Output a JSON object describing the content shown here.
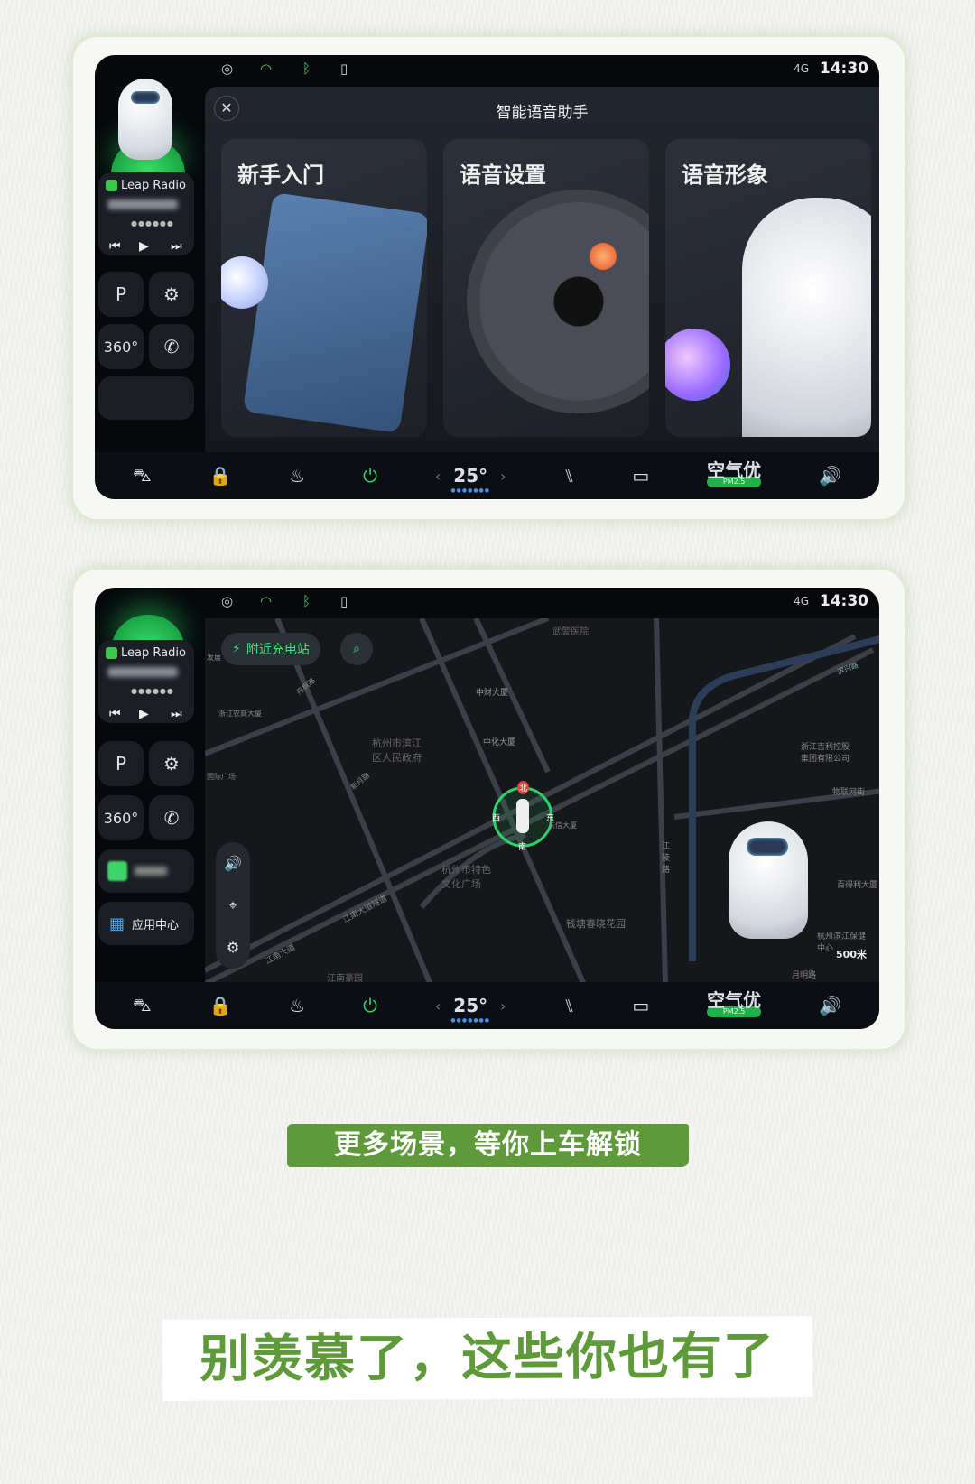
{
  "status": {
    "icons": [
      "user-icon",
      "wifi-icon",
      "bluetooth-icon",
      "phone-projection-icon"
    ],
    "signal": "4G",
    "time": "14:30"
  },
  "sidebar": {
    "radio_title": "Leap Radio",
    "app_center": "应用中心",
    "view_360": "360°"
  },
  "screen1": {
    "panel_title": "智能语音助手",
    "cards": [
      {
        "label": "新手入门"
      },
      {
        "label": "语音设置"
      },
      {
        "label": "语音形象"
      }
    ]
  },
  "screen2": {
    "charging_chip": "附近充电站",
    "scale": "500米",
    "map_labels": [
      "武警医院",
      "中财大厦",
      "中化大厦",
      "杭州市滨江区人民政府",
      "浙江吉利控股集团有限公司",
      "物联网街",
      "江陵路",
      "杭州市特色文化广场",
      "钱塘春晓花园",
      "江南大道隧道",
      "江南大道",
      "江南豪园",
      "百得利大厦",
      "杭州滨江保健中心",
      "月明路",
      "国际广场",
      "浙江农商大厦",
      "丹枫路",
      "新月路",
      "东信大厦",
      "滨兴路",
      "发展"
    ],
    "compass": {
      "n": "北",
      "s": "南",
      "e": "东",
      "w": "西"
    }
  },
  "climate": {
    "temperature": "25°",
    "air_quality": "空气优",
    "pm": "PM2.5",
    "accent": "#22b04a"
  },
  "banners": {
    "subtitle": "更多场景，等你上车解锁",
    "headline": "别羡慕了，这些你也有了",
    "color": "#5f9a3a"
  }
}
